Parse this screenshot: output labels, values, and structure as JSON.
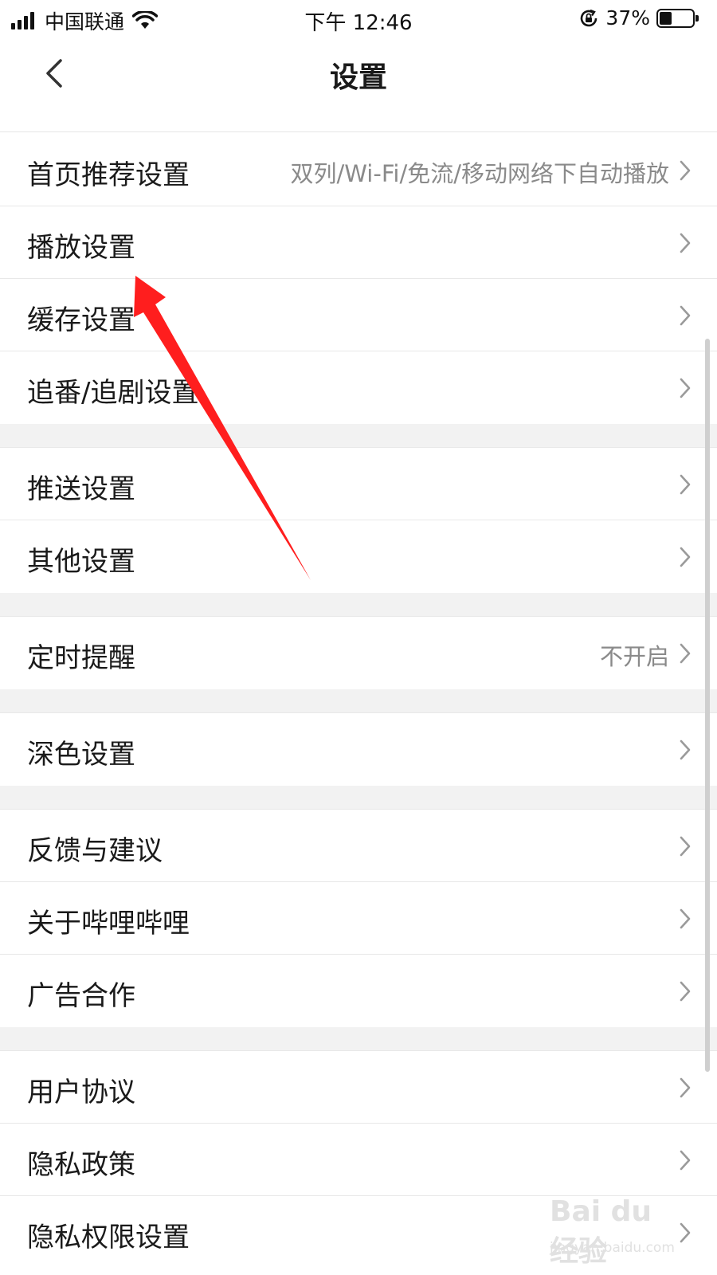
{
  "status_bar": {
    "carrier": "中国联通",
    "time": "下午 12:46",
    "battery_percent": "37%",
    "battery_level": 0.37
  },
  "nav": {
    "title": "设置",
    "back_icon": "chevron-left-icon"
  },
  "sections": [
    {
      "items": [
        {
          "label": "首页推荐设置",
          "value": "双列/Wi-Fi/免流/移动网络下自动播放"
        },
        {
          "label": "播放设置",
          "value": ""
        },
        {
          "label": "缓存设置",
          "value": ""
        },
        {
          "label": "追番/追剧设置",
          "value": ""
        }
      ]
    },
    {
      "items": [
        {
          "label": "推送设置",
          "value": ""
        },
        {
          "label": "其他设置",
          "value": ""
        }
      ]
    },
    {
      "items": [
        {
          "label": "定时提醒",
          "value": "不开启"
        }
      ]
    },
    {
      "items": [
        {
          "label": "深色设置",
          "value": ""
        }
      ]
    },
    {
      "items": [
        {
          "label": "反馈与建议",
          "value": ""
        },
        {
          "label": "关于哔哩哔哩",
          "value": ""
        },
        {
          "label": "广告合作",
          "value": ""
        }
      ]
    },
    {
      "items": [
        {
          "label": "用户协议",
          "value": ""
        },
        {
          "label": "隐私政策",
          "value": ""
        },
        {
          "label": "隐私权限设置",
          "value": ""
        }
      ]
    }
  ],
  "watermark": {
    "logo": "Bai du 经验",
    "url": "jingyan.baidu.com"
  },
  "colors": {
    "annotation_arrow": "#ff1e1e",
    "section_gap": "#f2f2f2",
    "secondary_text": "#8a8a8a"
  }
}
